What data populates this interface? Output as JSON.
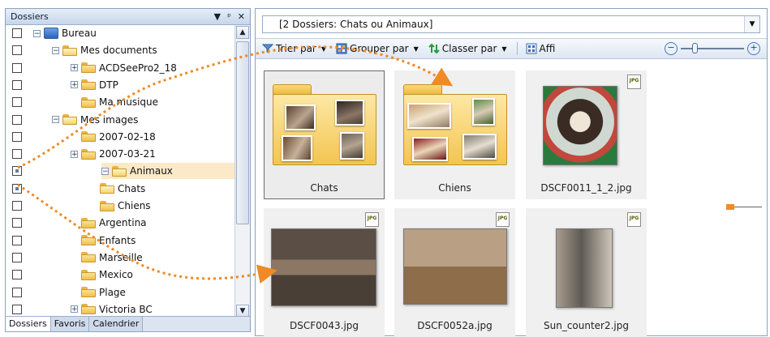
{
  "left_pane": {
    "title": "Dossiers",
    "controls": {
      "dropdown": "▼",
      "pin": "ᵖ",
      "close": "✕"
    },
    "tree": [
      {
        "label": "Bureau",
        "indent": 0,
        "exp": "⊟",
        "icon": "desktop"
      },
      {
        "label": "Mes documents",
        "indent": 1,
        "exp": "⊟",
        "icon": "folder-open"
      },
      {
        "label": "ACDSeePro2_18",
        "indent": 2,
        "exp": "⊞",
        "icon": "folder"
      },
      {
        "label": "DTP",
        "indent": 2,
        "exp": "⊞",
        "icon": "folder"
      },
      {
        "label": "Ma musique",
        "indent": 2,
        "exp": "",
        "icon": "folder"
      },
      {
        "label": "Mes images",
        "indent": 1,
        "exp": "⊟",
        "icon": "folder-open"
      },
      {
        "label": "2007-02-18",
        "indent": 2,
        "exp": "",
        "icon": "folder"
      },
      {
        "label": "2007-03-21",
        "indent": 2,
        "exp": "⊞",
        "icon": "folder"
      },
      {
        "label": "Animaux",
        "indent": 2,
        "exp": "⊟",
        "icon": "folder-open"
      },
      {
        "label": "Chats",
        "indent": 3,
        "exp": "",
        "icon": "folder-open"
      },
      {
        "label": "Chiens",
        "indent": 3,
        "exp": "",
        "icon": "folder"
      },
      {
        "label": "Argentina",
        "indent": 2,
        "exp": "",
        "icon": "folder"
      },
      {
        "label": "Enfants",
        "indent": 2,
        "exp": "",
        "icon": "folder"
      },
      {
        "label": "Marseille",
        "indent": 2,
        "exp": "",
        "icon": "folder"
      },
      {
        "label": "Mexico",
        "indent": 2,
        "exp": "",
        "icon": "folder"
      },
      {
        "label": "Plage",
        "indent": 2,
        "exp": "",
        "icon": "folder"
      },
      {
        "label": "Victoria BC",
        "indent": 2,
        "exp": "⊞",
        "icon": "folder"
      }
    ],
    "checkbox_partial_rows": [
      8,
      9
    ],
    "selected_row": 8,
    "tabs": [
      "Dossiers",
      "Favoris",
      "Calendrier"
    ]
  },
  "right_pane": {
    "path_text": "[2 Dossiers: Chats ou Animaux]",
    "path_dropdown": "▼",
    "toolbar": {
      "sort": "Trier par",
      "group": "Grouper par",
      "order": "Classer par",
      "view": "Affi"
    },
    "zoom": {
      "minus": "−",
      "plus": "+",
      "level": 0.15
    },
    "items": [
      {
        "label": "Chats",
        "type": "folder"
      },
      {
        "label": "Chiens",
        "type": "folder"
      },
      {
        "label": "DSCF0011_1_2.jpg",
        "type": "jpg",
        "badge": "JPG"
      },
      {
        "label": "DSCF0043.jpg",
        "type": "jpg",
        "badge": "JPG"
      },
      {
        "label": "DSCF0052a.jpg",
        "type": "jpg",
        "badge": "JPG"
      },
      {
        "label": "Sun_counter2.jpg",
        "type": "jpg",
        "badge": "JPG"
      }
    ]
  },
  "colors": {
    "accent_orange": "#f08a24",
    "selection": "#fce9c7",
    "folder_yellow": "#f3c552"
  }
}
